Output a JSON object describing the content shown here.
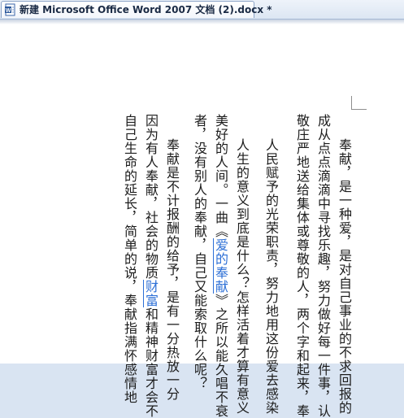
{
  "window": {
    "tab_title": "新建 Microsoft Office Word 2007 文档 (2).docx *"
  },
  "document": {
    "columns": [
      {
        "text": "奉献，是一种爱，是对自己事业的不求回报的",
        "indent": true
      },
      {
        "text": "成从点点滴滴中寻找乐趣，努力做好每一件事，认",
        "indent": false
      },
      {
        "text": "敬庄严地送给集体或尊敬的人，两个字和起来，奉",
        "indent": false
      },
      {
        "text": "人民赋予的光荣职责，努力地用这份爱去感染",
        "indent": true
      },
      {
        "text": "人生的意义到底是什么？怎样活着才算有意义",
        "indent": true
      },
      {
        "parts": [
          "美好的人间。一曲《",
          "爱的奉献",
          "》之所以能久唱不衰"
        ],
        "indent": false
      },
      {
        "text": "者，没有别人的奉献，自己又能索取什么呢？",
        "indent": false
      },
      {
        "text": "奉献是不计报酬的给予，是有一分热放一分",
        "indent": true
      },
      {
        "parts": [
          "因为有人奉献，社会的物质",
          "财富",
          "和精神财富才会不"
        ],
        "indent": false
      },
      {
        "text": "自己生命的延长，简单的说，奉献指满怀感情地",
        "indent": false
      }
    ]
  },
  "icons": {
    "document": "word-document-icon"
  }
}
